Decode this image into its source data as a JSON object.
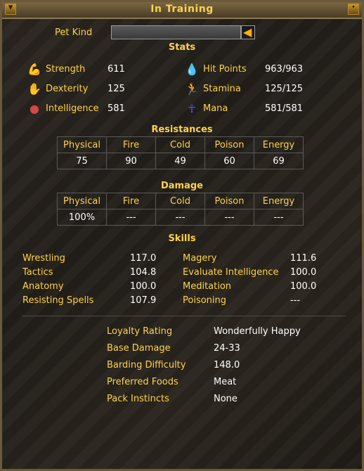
{
  "window": {
    "title": "In Training"
  },
  "pet_kind": {
    "label": "Pet Kind",
    "value": ""
  },
  "stats": {
    "heading": "Stats",
    "left": [
      {
        "label": "Strength",
        "value": "611",
        "icon": "strength-arm-icon",
        "color": "#c8a070"
      },
      {
        "label": "Dexterity",
        "value": "125",
        "icon": "dexterity-icon",
        "color": "#d09050"
      },
      {
        "label": "Intelligence",
        "value": "581",
        "icon": "brain-icon",
        "color": "#d04848"
      }
    ],
    "right": [
      {
        "label": "Hit Points",
        "value": "963/963",
        "icon": "blood-drop-icon",
        "color": "#d02020"
      },
      {
        "label": "Stamina",
        "value": "125/125",
        "icon": "running-man-icon",
        "color": "#ffd000"
      },
      {
        "label": "Mana",
        "value": "581/581",
        "icon": "ankh-icon",
        "color": "#5060ff"
      }
    ]
  },
  "resistances": {
    "heading": "Resistances",
    "headers": [
      "Physical",
      "Fire",
      "Cold",
      "Poison",
      "Energy"
    ],
    "values": [
      "75",
      "90",
      "49",
      "60",
      "69"
    ]
  },
  "damage": {
    "heading": "Damage",
    "headers": [
      "Physical",
      "Fire",
      "Cold",
      "Poison",
      "Energy"
    ],
    "values": [
      "100%",
      "---",
      "---",
      "---",
      "---"
    ]
  },
  "skills": {
    "heading": "Skills",
    "left": [
      {
        "label": "Wrestling",
        "value": "117.0"
      },
      {
        "label": "Tactics",
        "value": "104.8"
      },
      {
        "label": "Anatomy",
        "value": "100.0"
      },
      {
        "label": "Resisting Spells",
        "value": "107.9"
      }
    ],
    "right": [
      {
        "label": "Magery",
        "value": "111.6"
      },
      {
        "label": "Evaluate Intelligence",
        "value": "100.0"
      },
      {
        "label": "Meditation",
        "value": "100.0"
      },
      {
        "label": "Poisoning",
        "value": "---"
      }
    ]
  },
  "info": [
    {
      "label": "Loyalty Rating",
      "value": "Wonderfully Happy"
    },
    {
      "label": "Base Damage",
      "value": "24-33"
    },
    {
      "label": "Barding Difficulty",
      "value": "148.0"
    },
    {
      "label": "Preferred Foods",
      "value": "Meat"
    },
    {
      "label": "Pack Instincts",
      "value": "None"
    }
  ]
}
